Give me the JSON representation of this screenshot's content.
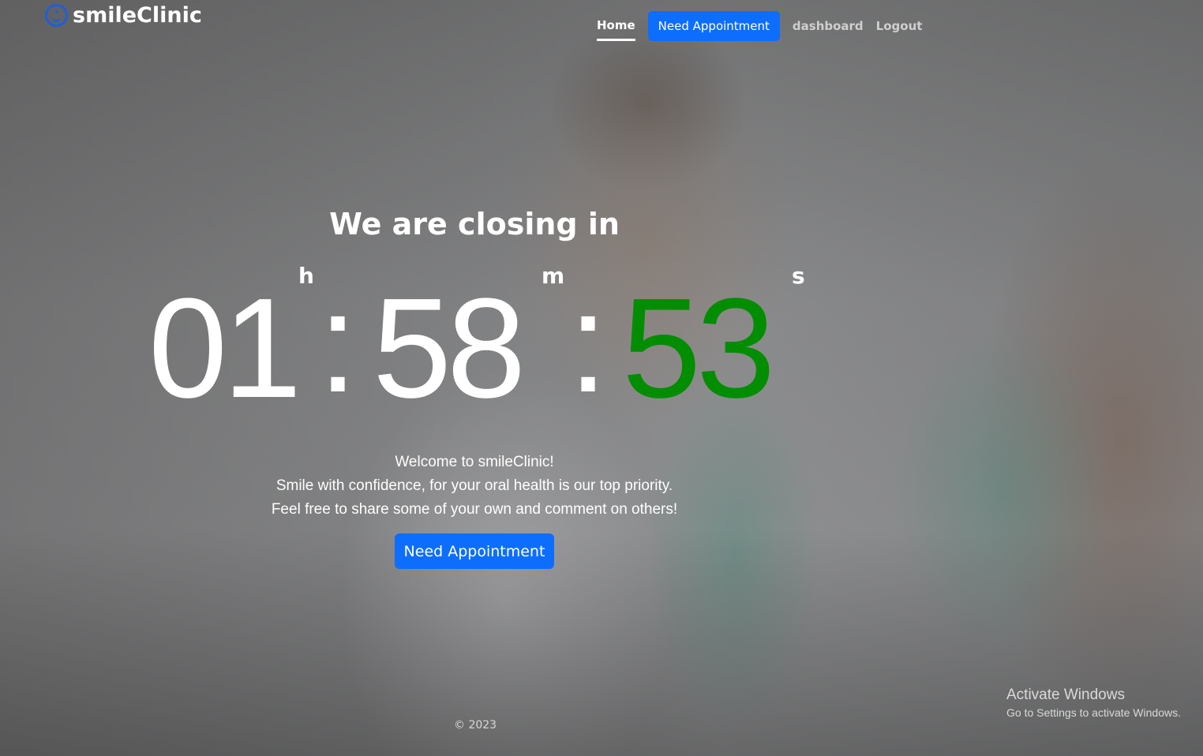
{
  "nav": {
    "brand": "smileClinic",
    "home_label": "Home",
    "appointment_label": "Need Appointment",
    "dashboard_label": "dashboard",
    "logout_label": "Logout"
  },
  "countdown": {
    "heading": "We are closing in",
    "unit_hours": "h",
    "unit_minutes": "m",
    "unit_seconds": "s",
    "hours": "01",
    "minutes": "58",
    "seconds": "53",
    "separator": ":"
  },
  "welcome": {
    "line1": "Welcome to smileClinic!",
    "line2": "Smile with confidence, for your oral health is our top priority.",
    "line3": "Feel free to share some of your own and comment on others!",
    "button_label": "Need Appointment"
  },
  "footer": {
    "copyright": "© 2023"
  },
  "watermark": {
    "title": "Activate Windows",
    "subtitle": "Go to Settings to activate Windows."
  },
  "colors": {
    "primary": "#0d6efd",
    "seconds": "#028d02",
    "brand_icon": "#1e5fd8"
  }
}
